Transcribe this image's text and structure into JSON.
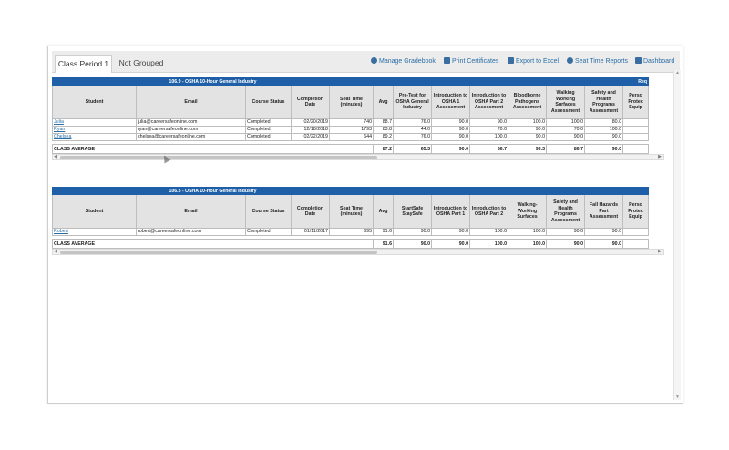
{
  "tabs": [
    {
      "label": "Class Period 1",
      "active": true
    },
    {
      "label": "Not Grouped",
      "active": false
    }
  ],
  "toolbar": {
    "manage_gradebook": "Manage Gradebook",
    "print_certificates": "Print Certificates",
    "export_excel": "Export to Excel",
    "seat_time_reports": "Seat Time Reports",
    "dashboard": "Dashboard"
  },
  "gradebooks": [
    {
      "title": "106.9 - OSHA 10-Hour General Industry",
      "title_extra": "Req",
      "headers": [
        "Student",
        "Email",
        "Course Status",
        "Completion Date",
        "Seat Time (minutes)",
        "Avg",
        "Pre-Test for OSHA General Industry",
        "Introduction to OSHA 1 Assessment",
        "Introduction to OSHA Part 2 Assessment",
        "Bloodborne Pathogens Assessment",
        "Walking Working Surfaces Assessment",
        "Safety and Health Programs Assessment",
        "Perso Protec Equip"
      ],
      "rows": [
        [
          "Julia",
          "julia@careersafeonline.com",
          "Completed",
          "02/20/2019",
          "740",
          "88.7",
          "76.0",
          "90.0",
          "90.0",
          "100.0",
          "100.0",
          "80.0",
          ""
        ],
        [
          "Ryan",
          "ryan@careersafeonline.com",
          "Completed",
          "12/18/2018",
          "1793",
          "83.8",
          "44.0",
          "90.0",
          "70.0",
          "90.0",
          "70.0",
          "100.0",
          ""
        ],
        [
          "Chelsea",
          "chelsea@careersafeonline.com",
          "Completed",
          "02/22/2019",
          "644",
          "89.2",
          "76.0",
          "90.0",
          "100.0",
          "90.0",
          "90.0",
          "90.0",
          ""
        ]
      ],
      "average_label": "CLASS AVERAGE",
      "averages": [
        "87.2",
        "65.3",
        "90.0",
        "86.7",
        "93.3",
        "86.7",
        "90.0",
        ""
      ]
    },
    {
      "title": "106.5 - OSHA 10-Hour General Industry",
      "title_extra": "",
      "headers": [
        "Student",
        "Email",
        "Course Status",
        "Completion Date",
        "Seat Time (minutes)",
        "Avg",
        "StartSafe StaySafe",
        "Introduction to OSHA Part 1",
        "Introduction to OSHA Part 2",
        "Walking-Working Surfaces",
        "Safety and Health Programs Assessment",
        "Fall Hazards Part Assessment",
        "Perso Protec Equip"
      ],
      "rows": [
        [
          "Robert",
          "robert@careersafeonline.com",
          "Completed",
          "01/11/2017",
          "695",
          "91.6",
          "90.0",
          "90.0",
          "100.0",
          "100.0",
          "90.0",
          "90.0",
          ""
        ]
      ],
      "average_label": "CLASS AVERAGE",
      "averages": [
        "91.6",
        "90.0",
        "90.0",
        "100.0",
        "100.0",
        "90.0",
        "90.0",
        ""
      ]
    }
  ]
}
